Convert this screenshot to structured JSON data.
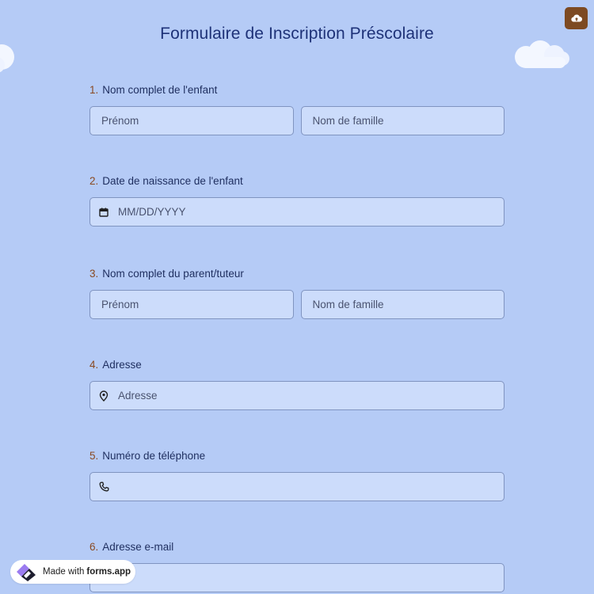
{
  "form": {
    "title": "Formulaire de Inscription Préscolaire"
  },
  "questions": [
    {
      "number": "1.",
      "label": "Nom complet de l'enfant",
      "fields": [
        "Prénom",
        "Nom de famille"
      ]
    },
    {
      "number": "2.",
      "label": "Date de naissance de l'enfant",
      "placeholder": "MM/DD/YYYY",
      "icon": "calendar-icon"
    },
    {
      "number": "3.",
      "label": "Nom complet du parent/tuteur",
      "fields": [
        "Prénom",
        "Nom de famille"
      ]
    },
    {
      "number": "4.",
      "label": "Adresse",
      "placeholder": "Adresse",
      "icon": "location-pin-icon"
    },
    {
      "number": "5.",
      "label": "Numéro de téléphone",
      "placeholder": "",
      "icon": "phone-icon"
    },
    {
      "number": "6.",
      "label": "Adresse e-mail"
    }
  ],
  "badge": {
    "prefix": "Made with",
    "brand": "forms.app"
  },
  "colors": {
    "background": "#b5cbf6",
    "field_bg": "#ccdcfb",
    "accent_number": "#8a4a22",
    "title": "#1e3278",
    "cloud_button": "#7d4a22"
  }
}
